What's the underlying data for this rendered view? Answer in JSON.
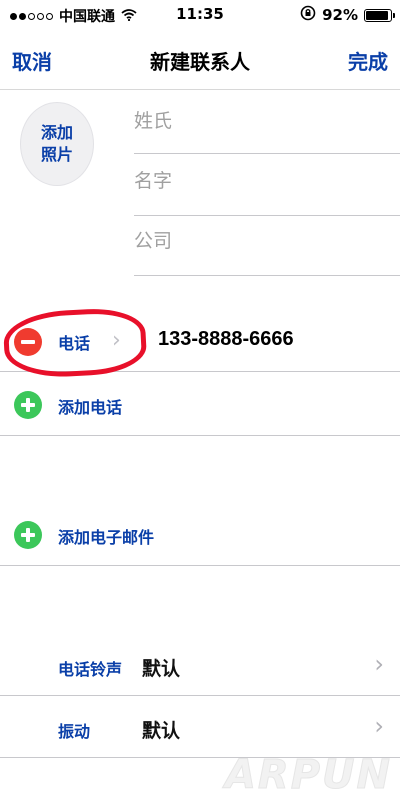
{
  "status_bar": {
    "signal_dots_filled": 2,
    "signal_dots_total": 5,
    "carrier": "中国联通",
    "wifi_icon": "wifi-icon",
    "time": "11:35",
    "orientation_lock_icon": "orientation-lock-icon",
    "battery_percent": "92%",
    "battery_level": 0.92
  },
  "nav": {
    "cancel_label": "取消",
    "title": "新建联系人",
    "done_label": "完成"
  },
  "photo": {
    "label_line1": "添加",
    "label_line2": "照片"
  },
  "fields": {
    "last_name_placeholder": "姓氏",
    "first_name_placeholder": "名字",
    "company_placeholder": "公司"
  },
  "phone": {
    "label": "电话",
    "value": "133-8888-6666",
    "highlight_color": "#e8102a"
  },
  "add_phone": {
    "label": "添加电话"
  },
  "add_email": {
    "label": "添加电子邮件"
  },
  "settings": {
    "ringtone_label": "电话铃声",
    "ringtone_value": "默认",
    "vibration_label": "振动",
    "vibration_value": "默认"
  },
  "watermark": "ARPUN",
  "colors": {
    "accent": "#0a3fa8",
    "delete": "#f03b2f",
    "add": "#3cc75a"
  }
}
